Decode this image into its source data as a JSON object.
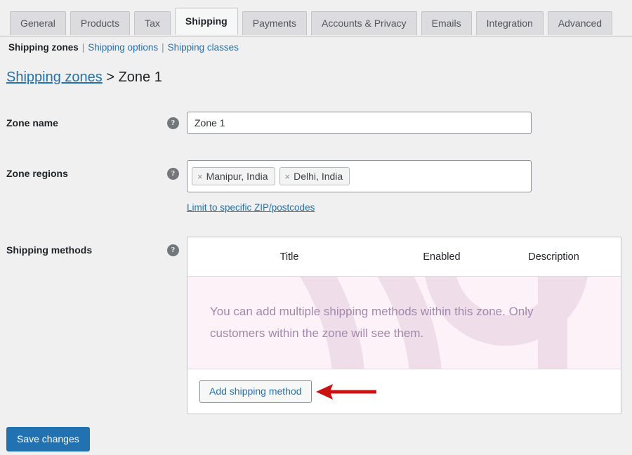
{
  "window": {
    "app": "WooCommerce Settings",
    "background_color": "#f0f0f1",
    "accent_color": "#2271b1"
  },
  "tabs": [
    {
      "label": "General",
      "active": false
    },
    {
      "label": "Products",
      "active": false
    },
    {
      "label": "Tax",
      "active": false
    },
    {
      "label": "Shipping",
      "active": true
    },
    {
      "label": "Payments",
      "active": false
    },
    {
      "label": "Accounts & Privacy",
      "active": false
    },
    {
      "label": "Emails",
      "active": false
    },
    {
      "label": "Integration",
      "active": false
    },
    {
      "label": "Advanced",
      "active": false
    }
  ],
  "subnav": {
    "current": "Shipping zones",
    "separator": "|",
    "links": [
      {
        "label": "Shipping options"
      },
      {
        "label": "Shipping classes"
      }
    ]
  },
  "breadcrumb": {
    "parent_link": "Shipping zones",
    "separator": ">",
    "current": "Zone 1"
  },
  "form": {
    "zone_name": {
      "label": "Zone name",
      "help_icon": "question-mark-icon",
      "value": "Zone 1",
      "placeholder": "Zone name"
    },
    "zone_regions": {
      "label": "Zone regions",
      "help_icon": "question-mark-icon",
      "chips": [
        {
          "remove_glyph": "×",
          "label": "Manipur, India"
        },
        {
          "remove_glyph": "×",
          "label": "Delhi, India"
        }
      ],
      "zip_link": "Limit to specific ZIP/postcodes"
    },
    "shipping_methods": {
      "label": "Shipping methods",
      "help_icon": "question-mark-icon",
      "columns": [
        "Title",
        "Enabled",
        "Description"
      ],
      "rows": [],
      "empty_message": "You can add multiple shipping methods within this zone. Only customers within the zone will see them.",
      "empty_message_color": "#a288ac",
      "empty_background_color": "#fcf2f8",
      "add_button": "Add shipping method"
    }
  },
  "annotation": {
    "arrow_icon": "red-arrow-left-icon",
    "arrow_color": "#cc1111",
    "points_at": "Add shipping method"
  },
  "footer": {
    "save_label": "Save changes"
  }
}
